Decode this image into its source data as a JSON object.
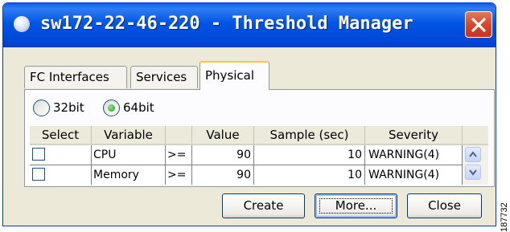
{
  "window": {
    "title": "sw172-22-46-220 - Threshold Manager",
    "close_icon": "close-icon"
  },
  "tabs": [
    {
      "label": "FC Interfaces",
      "selected": false
    },
    {
      "label": "Services",
      "selected": false
    },
    {
      "label": "Physical",
      "selected": true
    }
  ],
  "bitmode": {
    "options": [
      {
        "label": "32bit",
        "selected": false
      },
      {
        "label": "64bit",
        "selected": true
      }
    ]
  },
  "table": {
    "columns": [
      "Select",
      "Variable",
      "",
      "Value",
      "Sample (sec)",
      "Severity"
    ],
    "rows": [
      {
        "selected": false,
        "variable": "CPU",
        "operator": ">=",
        "value": "90",
        "sample": "10",
        "severity": "WARNING(4)"
      },
      {
        "selected": false,
        "variable": "Memory",
        "operator": ">=",
        "value": "90",
        "sample": "10",
        "severity": "WARNING(4)"
      }
    ]
  },
  "buttons": {
    "create": "Create",
    "more": "More...",
    "close": "Close"
  },
  "figure_id": "187732",
  "colors": {
    "titlebar": "#0055e5",
    "close_button": "#d5472a",
    "selected_tab_accent": "#ffc83c",
    "radio_selected": "#21a121"
  }
}
